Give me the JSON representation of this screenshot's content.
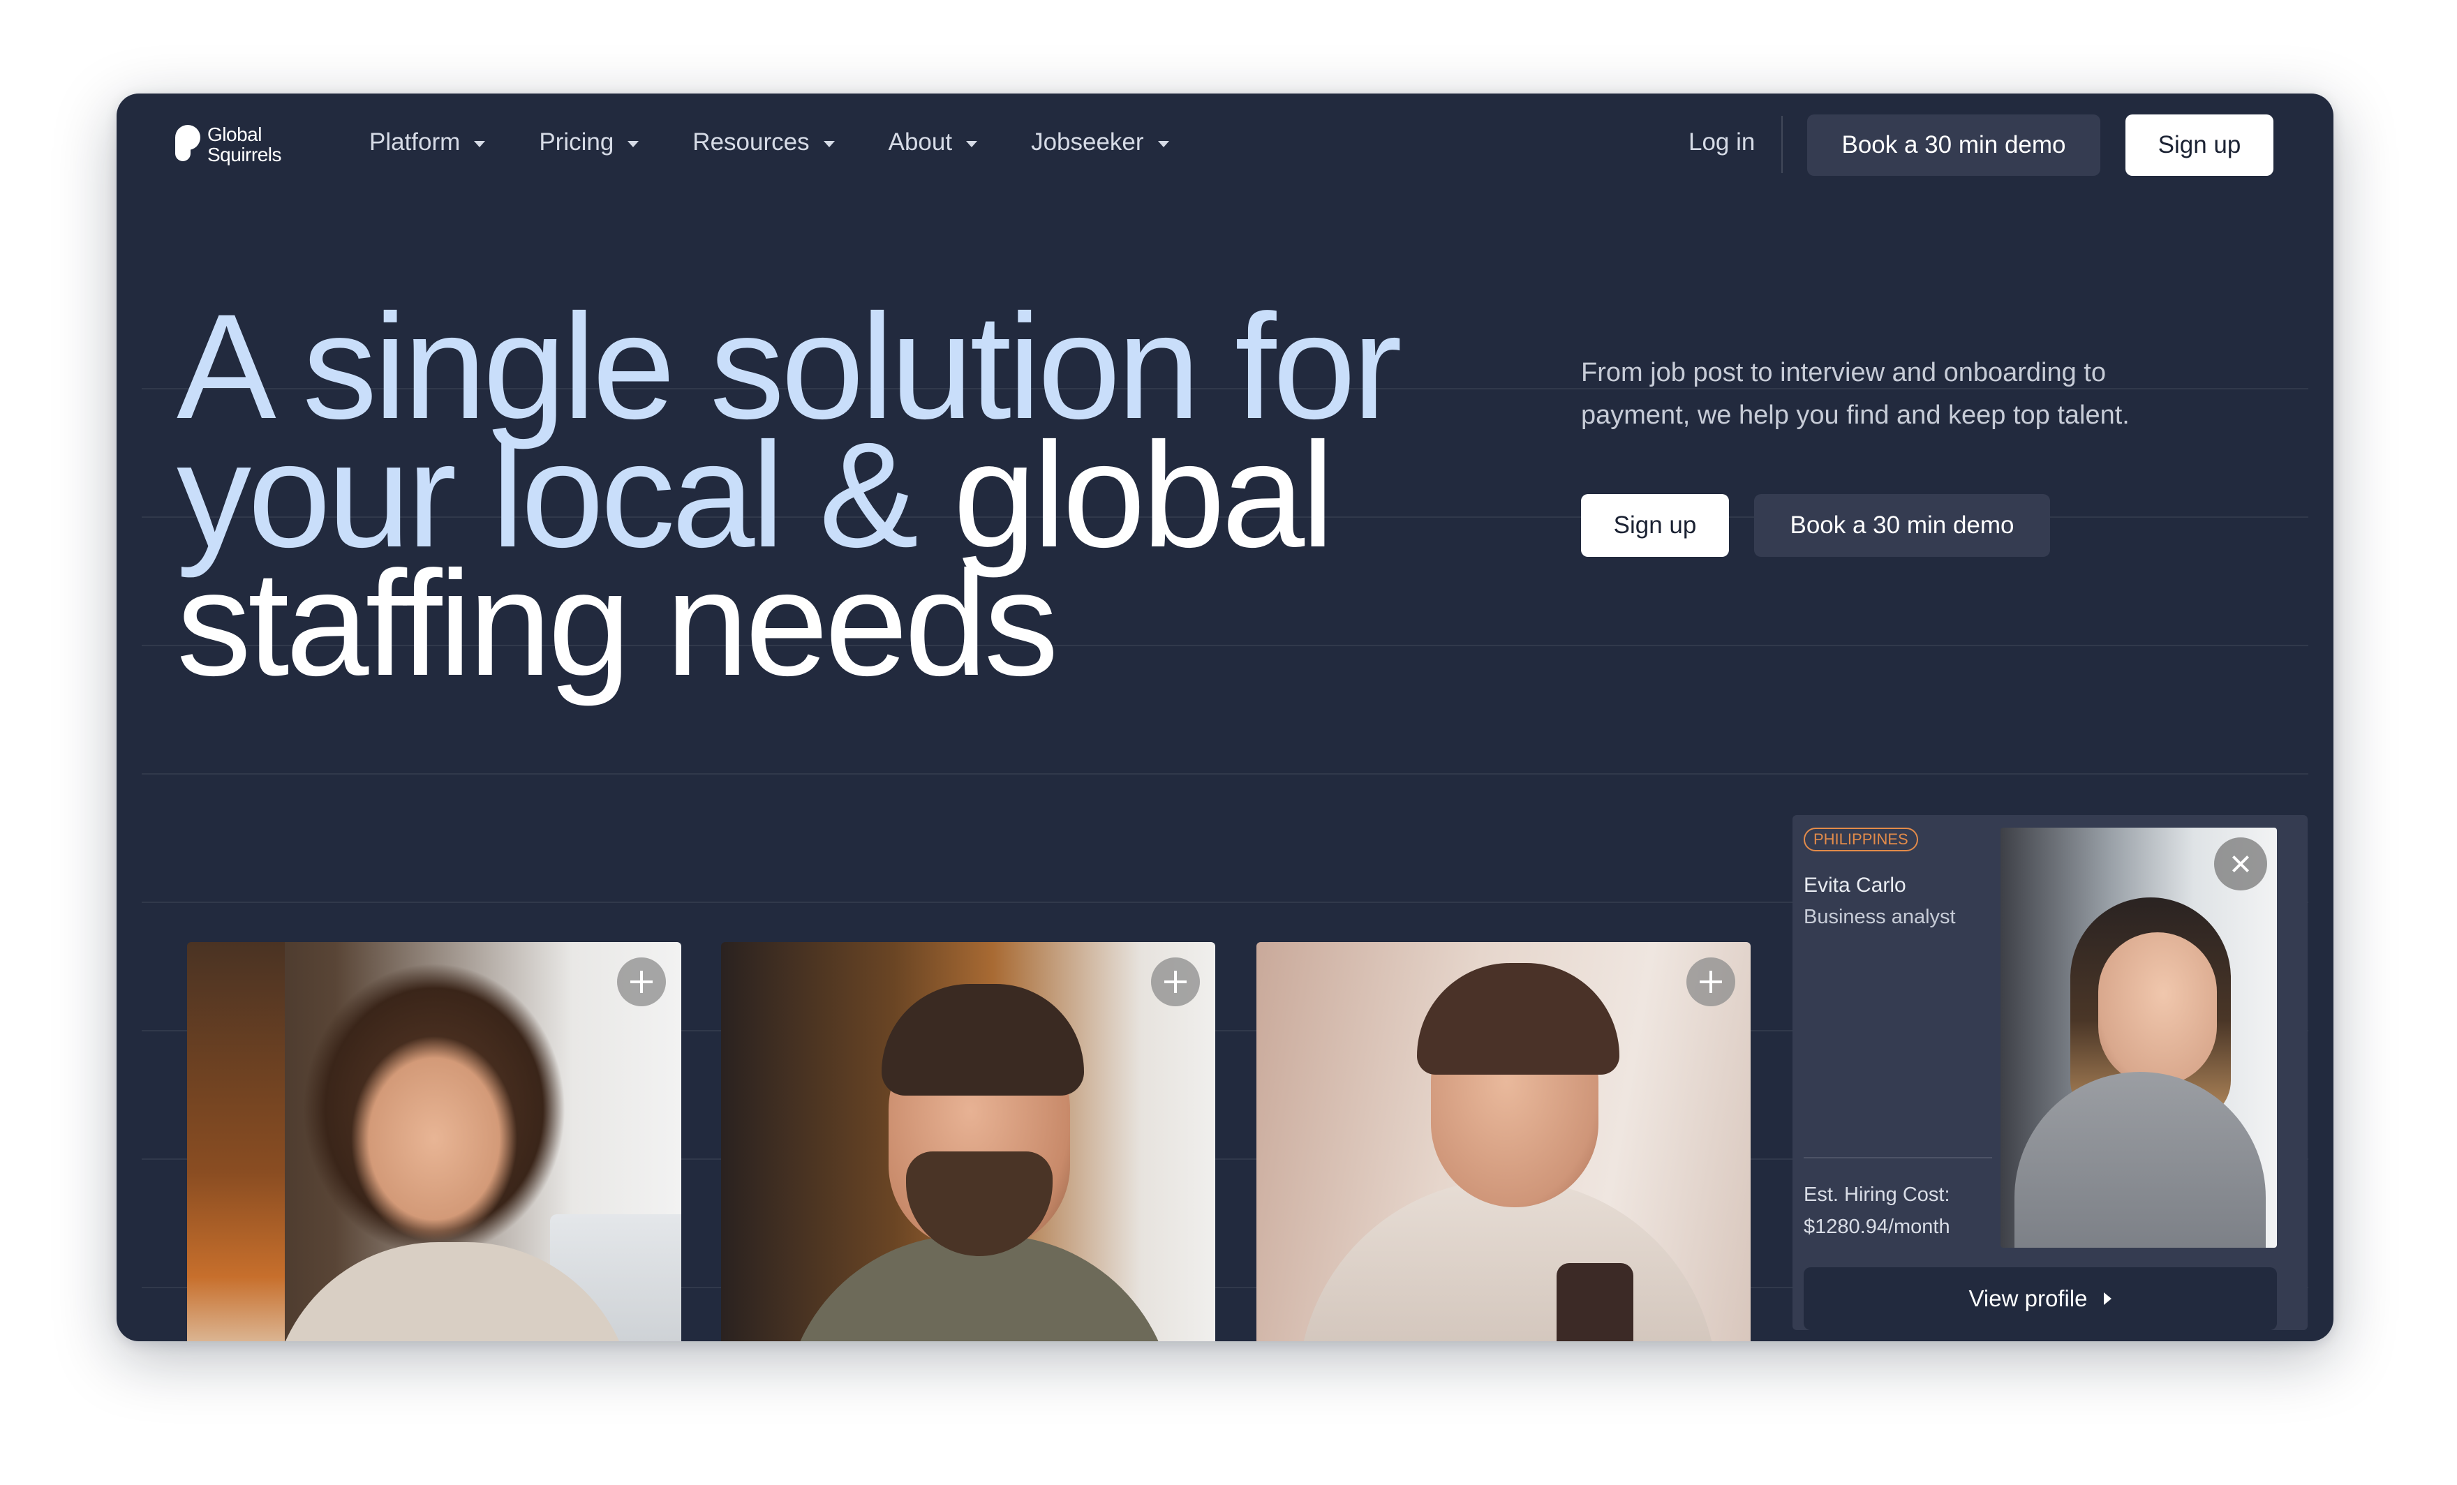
{
  "brand": {
    "line1": "Global",
    "line2": "Squirrels"
  },
  "nav": {
    "items": [
      {
        "label": "Platform"
      },
      {
        "label": "Pricing"
      },
      {
        "label": "Resources"
      },
      {
        "label": "About"
      },
      {
        "label": "Jobseeker"
      }
    ],
    "login": "Log in",
    "demo": "Book a 30 min demo",
    "signup": "Sign up"
  },
  "hero": {
    "title_part1": "A single solution for your local & ",
    "title_part2": "global staffing needs",
    "description": "From job post to interview and onboarding to payment, we help you find and keep top talent.",
    "signup": "Sign up",
    "demo": "Book a 30 min demo"
  },
  "profile": {
    "badge": "PHILIPPINES",
    "name": "Evita Carlo",
    "role": "Business analyst",
    "cost_label": "Est. Hiring Cost:",
    "cost_value": "$1280.94/month",
    "view": "View profile"
  },
  "colors": {
    "background": "#222a3e",
    "surface": "#353c51",
    "headline_light": "#c9defa",
    "badge": "#e38b4a"
  },
  "icons": [
    "caret-down-icon",
    "plus-icon",
    "close-icon",
    "caret-right-icon"
  ]
}
